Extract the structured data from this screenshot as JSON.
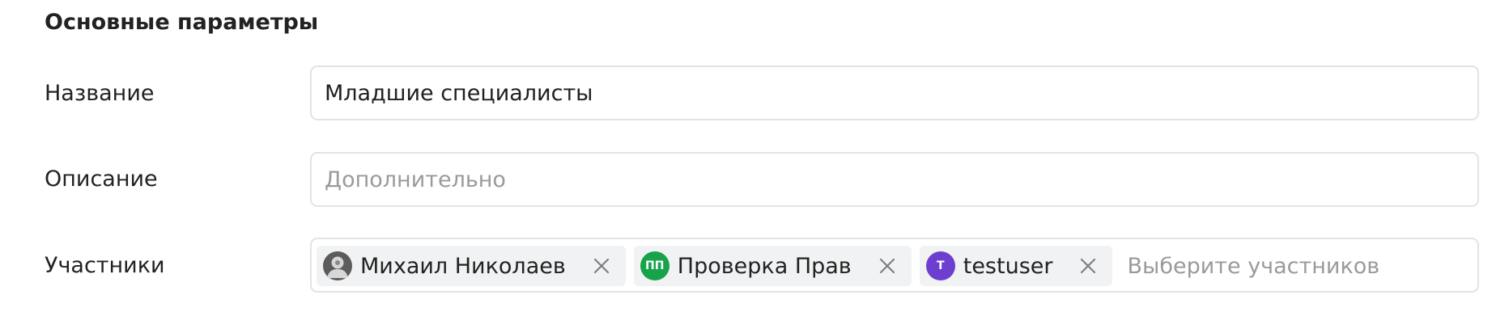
{
  "section": {
    "title": "Основные параметры"
  },
  "fields": {
    "name": {
      "label": "Название",
      "value": "Младшие специалисты"
    },
    "description": {
      "label": "Описание",
      "placeholder": "Дополнительно"
    },
    "members": {
      "label": "Участники",
      "placeholder": "Выберите участников",
      "chips": [
        {
          "name": "Михаил Николаев",
          "avatar_type": "photo",
          "avatar_initials": "",
          "avatar_color": "#6b6b6b"
        },
        {
          "name": "Проверка Прав",
          "avatar_type": "initials",
          "avatar_initials": "ПП",
          "avatar_color": "#16a34a"
        },
        {
          "name": "testuser",
          "avatar_type": "initials",
          "avatar_initials": "T",
          "avatar_color": "#6d3fd1"
        }
      ]
    }
  },
  "icons": {
    "remove": "close-icon",
    "photo": "user-photo-avatar"
  }
}
